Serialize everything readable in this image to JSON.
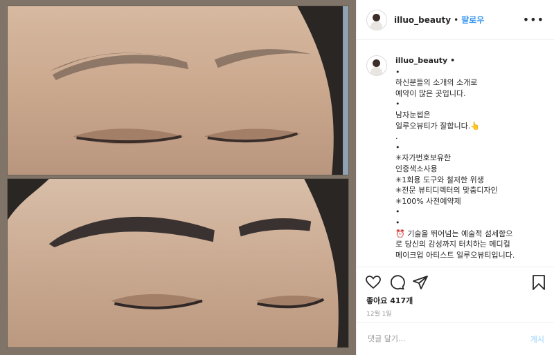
{
  "post": {
    "username": "illuo_beauty",
    "follow_label": "팔로우",
    "more_label": "•••",
    "separator": "•"
  },
  "caption": {
    "username": "illuo_beauty",
    "lines": [
      "•",
      "하신분들의 소개의 소개로",
      "예약이 많은 곳입니다.",
      "•",
      "남자눈썹은",
      "일루오뷰티가 잘합니다.👆",
      ".",
      "•",
      "✳자가번호보유한",
      "인증색소사용",
      "✳1회용 도구와 철저한 위생",
      "✳전문 뷰티디렉터의 맞춤디자인",
      "✳100% 사전예약제",
      "•",
      "•",
      "⏰ 기술을 뛰어넘는 예술적 섬세함으",
      "로 당신의 감성까지 터치하는 메디컬",
      "메이크업 아티스트 일루오뷰티입니다.",
      "•"
    ]
  },
  "stats": {
    "likes": "좋아요 417개",
    "date": "12월 1일"
  },
  "comment": {
    "placeholder": "댓글 달기...",
    "post_label": "게시"
  },
  "icons": {
    "like": "heart-icon",
    "comment": "comment-icon",
    "share": "share-icon",
    "save": "bookmark-icon"
  }
}
